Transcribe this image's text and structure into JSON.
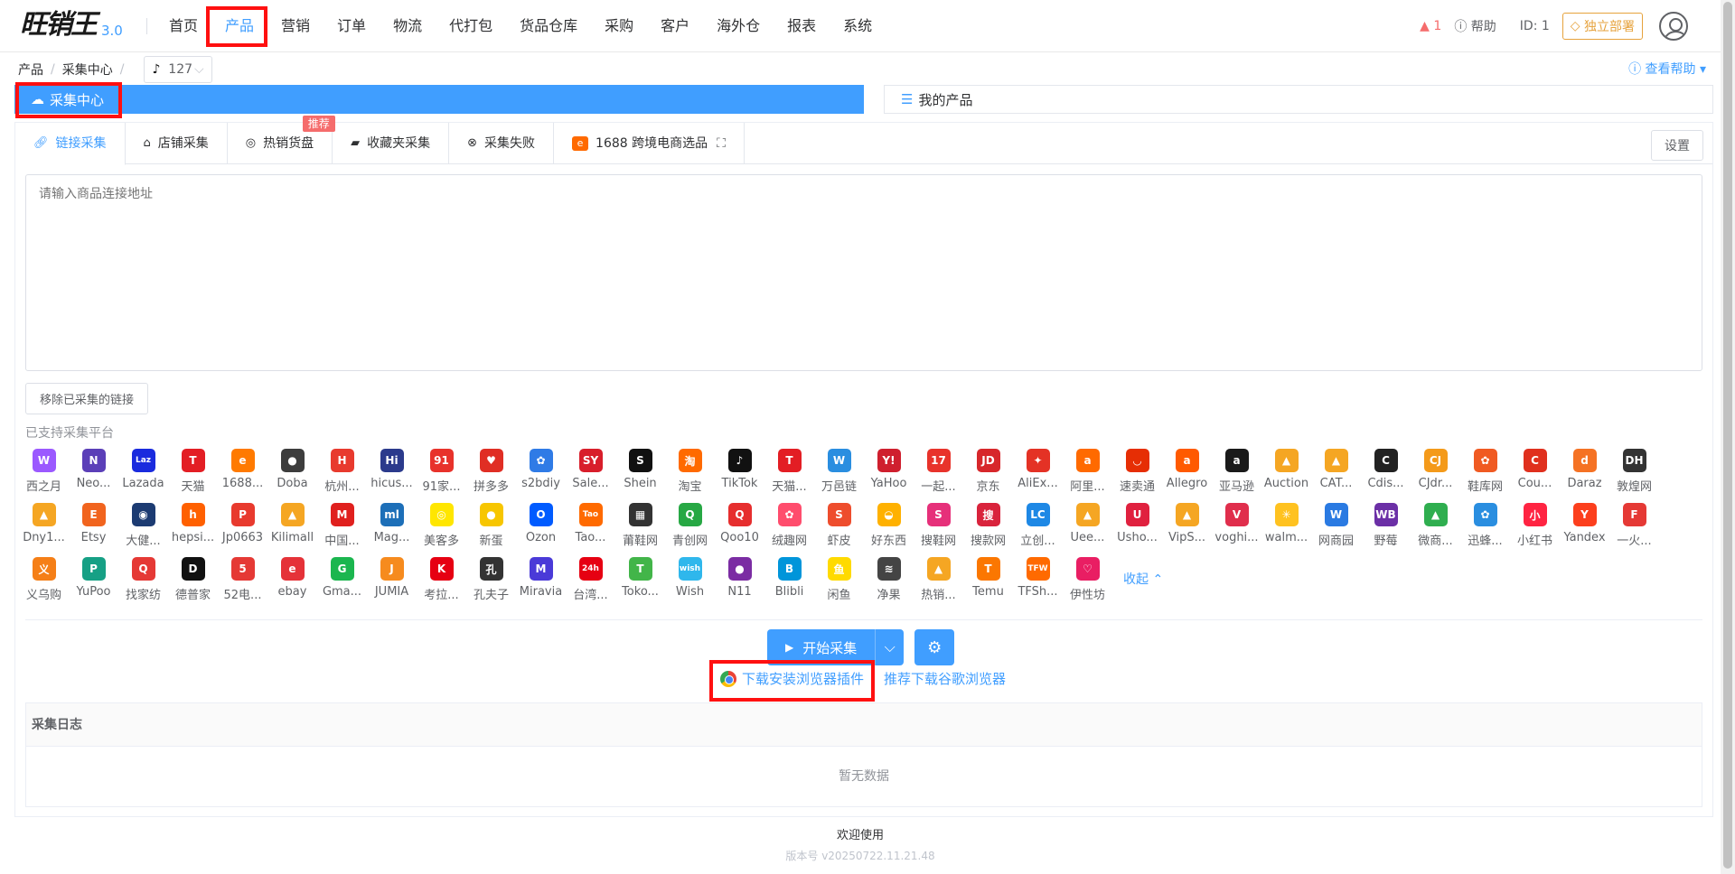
{
  "app": {
    "logo_text": "旺销王",
    "version": "3.0"
  },
  "nav": {
    "items": [
      "首页",
      "产品",
      "营销",
      "订单",
      "物流",
      "代打包",
      "货品仓库",
      "采购",
      "客户",
      "海外仓",
      "报表",
      "系统"
    ],
    "active_index": 1
  },
  "topright": {
    "warning_count": "1",
    "help_label": "帮助",
    "id_label": "ID: 1",
    "deploy_label": "独立部署"
  },
  "breadcrumb": {
    "items": [
      "产品",
      "采集中心"
    ],
    "shop_count": "127"
  },
  "help_link": "查看帮助",
  "steps": {
    "current": "采集中心",
    "next": "我的产品"
  },
  "tabs": [
    {
      "label": "链接采集",
      "icon": "link-icon"
    },
    {
      "label": "店铺采集",
      "icon": "home-icon"
    },
    {
      "label": "热销货盘",
      "icon": "target-icon"
    },
    {
      "label": "收藏夹采集",
      "icon": "folder-icon"
    },
    {
      "label": "采集失败",
      "icon": "x-circle-icon"
    },
    {
      "label": "1688 跨境电商选品",
      "icon": "1688-icon"
    }
  ],
  "tab_badge": "推荐",
  "settings_label": "设置",
  "url_input": {
    "placeholder": "请输入商品连接地址",
    "value": ""
  },
  "remove_collected_label": "移除已采集的链接",
  "platforms_title": "已支持采集平台",
  "platform_rows": [
    [
      [
        "西之月",
        "#9b59ff",
        "W"
      ],
      [
        "Neo...",
        "#5b3fb8",
        "N"
      ],
      [
        "Lazada",
        "#1a2bde",
        "Laz"
      ],
      [
        "天猫",
        "#e31e24",
        "T"
      ],
      [
        "1688...",
        "#ff7a00",
        "e"
      ],
      [
        "Doba",
        "#3d3d3d",
        "●"
      ],
      [
        "杭州...",
        "#e83a2e",
        "H"
      ],
      [
        "hicus...",
        "#2b3a8c",
        "Hi"
      ],
      [
        "91家...",
        "#e8322b",
        "91"
      ],
      [
        "拼多多",
        "#e02e24",
        "♥"
      ],
      [
        "s2bdiy",
        "#2f7be6",
        "✿"
      ],
      [
        "Sale...",
        "#d81e2b",
        "SY"
      ],
      [
        "Shein",
        "#111111",
        "S"
      ],
      [
        "淘宝",
        "#ff6a00",
        "淘"
      ],
      [
        "TikTok",
        "#111111",
        "♪"
      ],
      [
        "天猫...",
        "#e31e24",
        "T"
      ],
      [
        "万邑链",
        "#2a8ee0",
        "W"
      ],
      [
        "YaHoo",
        "#cf1f2e",
        "Y!"
      ],
      [
        "一起...",
        "#e8332b",
        "17"
      ],
      [
        "京东",
        "#d7272b",
        "JD"
      ],
      [
        "AliEx...",
        "#e43225",
        "✦"
      ],
      [
        "阿里...",
        "#ff6a00",
        "a"
      ],
      [
        "速卖通",
        "#e62e04",
        "◡"
      ],
      [
        "Allegro",
        "#ff5a00",
        "a"
      ],
      [
        "亚马逊",
        "#1a1a1a",
        "a"
      ],
      [
        "Auction",
        "#f5a623",
        "▲"
      ],
      [
        "CAT...",
        "#f5a623",
        "▲"
      ],
      [
        "Cdis...",
        "#222222",
        "C"
      ],
      [
        "CJdr...",
        "#f49a1a",
        "CJ"
      ],
      [
        "鞋库网",
        "#f05a22",
        "✿"
      ],
      [
        "Cou...",
        "#e0301e",
        "C"
      ],
      [
        "Daraz",
        "#f57224",
        "d"
      ],
      [
        "敦煌网",
        "#333333",
        "DH"
      ]
    ],
    [
      [
        "Dny1...",
        "#f5a623",
        "▲"
      ],
      [
        "Etsy",
        "#f1641e",
        "E"
      ],
      [
        "大健...",
        "#1c3b72",
        "◉"
      ],
      [
        "hepsi...",
        "#ff6000",
        "h"
      ],
      [
        "Jp0663",
        "#e83a2e",
        "P"
      ],
      [
        "Kilimall",
        "#f5a623",
        "▲"
      ],
      [
        "中国...",
        "#e0201e",
        "M"
      ],
      [
        "Mag...",
        "#1d6fb8",
        "ml"
      ],
      [
        "美客多",
        "#ffe600",
        "◎"
      ],
      [
        "新蛋",
        "#f7c600",
        "●"
      ],
      [
        "Ozon",
        "#005bff",
        "O"
      ],
      [
        "Tao...",
        "#ff6a00",
        "Tao"
      ],
      [
        "莆鞋网",
        "#333333",
        "▦"
      ],
      [
        "青创网",
        "#27a844",
        "Q"
      ],
      [
        "Qoo10",
        "#e62e2e",
        "Q"
      ],
      [
        "绒趣网",
        "#ff4d6d",
        "✿"
      ],
      [
        "虾皮",
        "#ee4d2d",
        "S"
      ],
      [
        "好东西",
        "#ffb100",
        "◒"
      ],
      [
        "搜鞋网",
        "#e6307a",
        "S"
      ],
      [
        "搜款网",
        "#d9233c",
        "搜"
      ],
      [
        "立创...",
        "#1e88e5",
        "LC"
      ],
      [
        "Uee...",
        "#f5a623",
        "▲"
      ],
      [
        "Usho...",
        "#e0213f",
        "U"
      ],
      [
        "VipS...",
        "#f5a623",
        "▲"
      ],
      [
        "voghi...",
        "#e02e4c",
        "V"
      ],
      [
        "walm...",
        "#ffc220",
        "✳"
      ],
      [
        "网商园",
        "#2a7ae2",
        "W"
      ],
      [
        "野莓",
        "#6b2fa6",
        "WB"
      ],
      [
        "微商...",
        "#2fae4f",
        "▲"
      ],
      [
        "迅蜂...",
        "#2a8ee0",
        "✿"
      ],
      [
        "小红书",
        "#ff2442",
        "小"
      ],
      [
        "Yandex",
        "#fc3f1d",
        "Y"
      ],
      [
        "一火...",
        "#e53935",
        "F"
      ]
    ],
    [
      [
        "义乌购",
        "#f57f17",
        "义"
      ],
      [
        "YuPoo",
        "#16a085",
        "P"
      ],
      [
        "找家纺",
        "#e53935",
        "Q"
      ],
      [
        "德普家",
        "#111111",
        "D"
      ],
      [
        "52电...",
        "#e53935",
        "5"
      ],
      [
        "ebay",
        "#e53238",
        "e"
      ],
      [
        "Gma...",
        "#1bb64f",
        "G"
      ],
      [
        "JUMIA",
        "#f68b1e",
        "J"
      ],
      [
        "考拉...",
        "#e60012",
        "K"
      ],
      [
        "孔夫子",
        "#333333",
        "孔"
      ],
      [
        "Miravia",
        "#4a3ad8",
        "M"
      ],
      [
        "台湾...",
        "#e60012",
        "24h"
      ],
      [
        "Toko...",
        "#42b549",
        "T"
      ],
      [
        "Wish",
        "#2fb7ec",
        "wish"
      ],
      [
        "N11",
        "#7b2ca3",
        "●"
      ],
      [
        "Blibli",
        "#0095da",
        "B"
      ],
      [
        "闲鱼",
        "#ffda00",
        "鱼"
      ],
      [
        "净果",
        "#444444",
        "≋"
      ],
      [
        "热销...",
        "#f5a623",
        "▲"
      ],
      [
        "Temu",
        "#fb7701",
        "T"
      ],
      [
        "TFSh...",
        "#ff6a00",
        "TFW"
      ],
      [
        "伊性坊",
        "#e91e63",
        "♡"
      ]
    ]
  ],
  "collapse_label": "收起",
  "start_label": "开始采集",
  "download_plugin_label": "下载安装浏览器插件",
  "recommend_chrome_label": "推荐下载谷歌浏览器",
  "log": {
    "title": "采集日志",
    "empty": "暂无数据"
  },
  "footer": {
    "welcome": "欢迎使用",
    "version": "版本号 v20250722.11.21.48"
  },
  "colors": {
    "primary": "#409eff",
    "highlight": "#ff1010",
    "warning": "#e6a23c",
    "danger": "#f56c6c"
  }
}
